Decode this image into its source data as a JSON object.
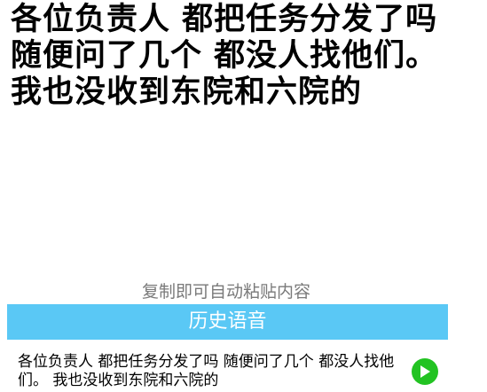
{
  "transcript": {
    "text": "各位负责人 都把任务分发了吗 随便问了几个 都没人找他们。 我也没收到东院和六院的"
  },
  "copy_hint": "复制即可自动粘贴内容",
  "history": {
    "title": "历史语音",
    "items": [
      {
        "text": "各位负责人 都把任务分发了吗  随便问了几个 都没人找他们。 我也没收到东院和六院的",
        "play_icon": "play-icon",
        "play_color": "#22c322"
      }
    ]
  },
  "colors": {
    "accent_bar": "#5ac8f5",
    "hint_text": "#7a7a7a"
  }
}
